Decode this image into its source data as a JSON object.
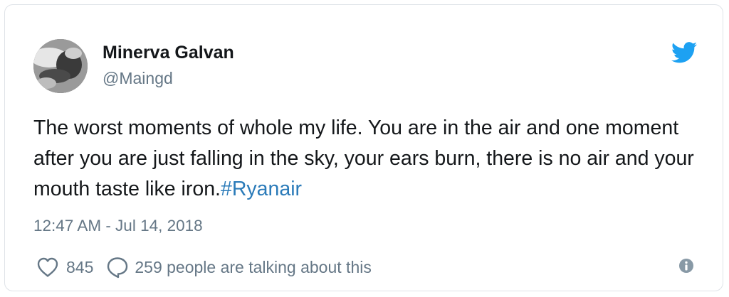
{
  "tweet": {
    "user": {
      "name": "Minerva Galvan",
      "handle": "@Maingd"
    },
    "text": "The worst moments of whole my life. You are in the air and one moment after you are just falling in the sky, your ears burn, there is no air and your mouth taste like iron.",
    "hashtag": "#Ryanair",
    "timestamp": "12:47 AM - Jul 14, 2018",
    "like_count": "845",
    "conversation_text": "259 people are talking about this"
  },
  "colors": {
    "accent": "#1da1f2",
    "hashtag": "#2b7bb9",
    "secondary_text": "#657786",
    "primary_text": "#14171a",
    "border": "#dfe3e8"
  },
  "icons": {
    "brand": "twitter-bird-icon",
    "like": "heart-outline-icon",
    "reply": "speech-bubble-icon",
    "info": "info-circle-icon"
  }
}
